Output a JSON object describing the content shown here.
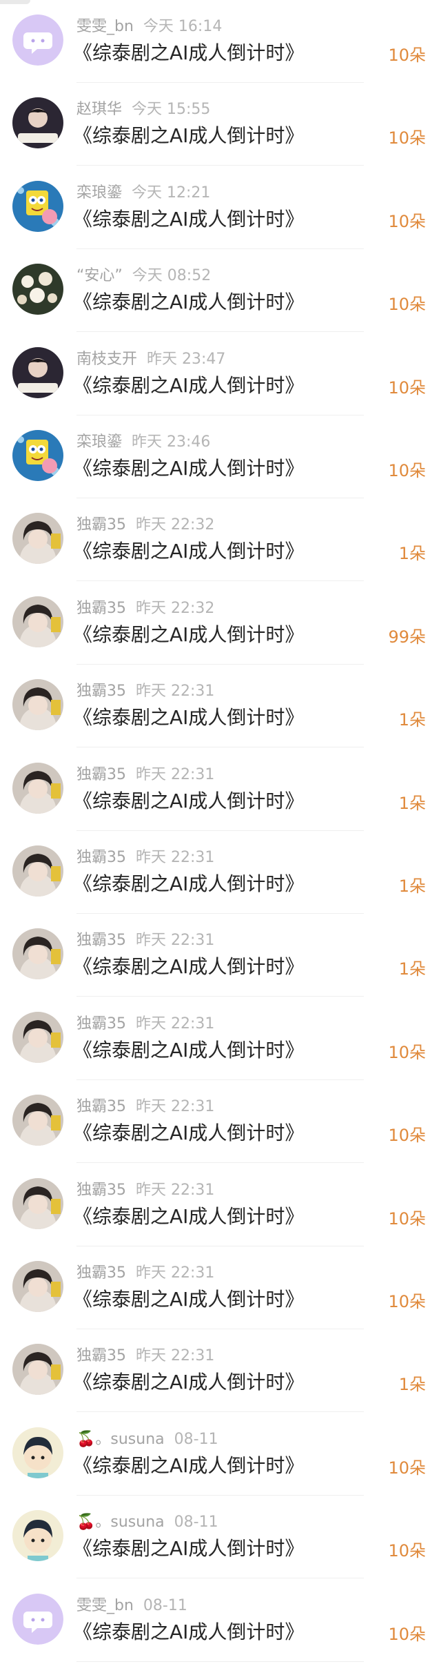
{
  "items": [
    {
      "user": "雯雯_bn",
      "time": "今天 16:14",
      "title": "《综泰剧之AI成人倒计时》",
      "amount": "10朵",
      "avatar": "bubble-icon"
    },
    {
      "user": "赵琪华",
      "time": "今天 15:55",
      "title": "《综泰剧之AI成人倒计时》",
      "amount": "10朵",
      "avatar": "person-photo"
    },
    {
      "user": "栾琅鎏",
      "time": "今天 12:21",
      "title": "《综泰剧之AI成人倒计时》",
      "amount": "10朵",
      "avatar": "sponge-cartoon"
    },
    {
      "user": "“安心”",
      "time": "今天 08:52",
      "title": "《综泰剧之AI成人倒计时》",
      "amount": "10朵",
      "avatar": "flowers-photo"
    },
    {
      "user": "南枝支开",
      "time": "昨天 23:47",
      "title": "《综泰剧之AI成人倒计时》",
      "amount": "10朵",
      "avatar": "person-photo"
    },
    {
      "user": "栾琅鎏",
      "time": "昨天 23:46",
      "title": "《综泰剧之AI成人倒计时》",
      "amount": "10朵",
      "avatar": "sponge-cartoon"
    },
    {
      "user": "独霸35",
      "time": "昨天 22:32",
      "title": "《综泰剧之AI成人倒计时》",
      "amount": "1朵",
      "avatar": "girl-photo"
    },
    {
      "user": "独霸35",
      "time": "昨天 22:32",
      "title": "《综泰剧之AI成人倒计时》",
      "amount": "99朵",
      "avatar": "girl-photo"
    },
    {
      "user": "独霸35",
      "time": "昨天 22:31",
      "title": "《综泰剧之AI成人倒计时》",
      "amount": "1朵",
      "avatar": "girl-photo"
    },
    {
      "user": "独霸35",
      "time": "昨天 22:31",
      "title": "《综泰剧之AI成人倒计时》",
      "amount": "1朵",
      "avatar": "girl-photo"
    },
    {
      "user": "独霸35",
      "time": "昨天 22:31",
      "title": "《综泰剧之AI成人倒计时》",
      "amount": "1朵",
      "avatar": "girl-photo"
    },
    {
      "user": "独霸35",
      "time": "昨天 22:31",
      "title": "《综泰剧之AI成人倒计时》",
      "amount": "1朵",
      "avatar": "girl-photo"
    },
    {
      "user": "独霸35",
      "time": "昨天 22:31",
      "title": "《综泰剧之AI成人倒计时》",
      "amount": "10朵",
      "avatar": "girl-photo"
    },
    {
      "user": "独霸35",
      "time": "昨天 22:31",
      "title": "《综泰剧之AI成人倒计时》",
      "amount": "10朵",
      "avatar": "girl-photo"
    },
    {
      "user": "独霸35",
      "time": "昨天 22:31",
      "title": "《综泰剧之AI成人倒计时》",
      "amount": "10朵",
      "avatar": "girl-photo"
    },
    {
      "user": "独霸35",
      "time": "昨天 22:31",
      "title": "《综泰剧之AI成人倒计时》",
      "amount": "10朵",
      "avatar": "girl-photo"
    },
    {
      "user": "独霸35",
      "time": "昨天 22:31",
      "title": "《综泰剧之AI成人倒计时》",
      "amount": "1朵",
      "avatar": "girl-photo"
    },
    {
      "user": "🍒。susuna",
      "time": "08-11",
      "title": "《综泰剧之AI成人倒计时》",
      "amount": "10朵",
      "avatar": "boy-cartoon"
    },
    {
      "user": "🍒。susuna",
      "time": "08-11",
      "title": "《综泰剧之AI成人倒计时》",
      "amount": "10朵",
      "avatar": "boy-cartoon"
    },
    {
      "user": "雯雯_bn",
      "time": "08-11",
      "title": "《综泰剧之AI成人倒计时》",
      "amount": "10朵",
      "avatar": "bubble-icon"
    }
  ],
  "colors": {
    "amount": "#e08a3c",
    "username": "#a3a3a3",
    "title": "#262626",
    "divider": "#efefef",
    "bubble_avatar_bg": "#d8c8f5"
  }
}
